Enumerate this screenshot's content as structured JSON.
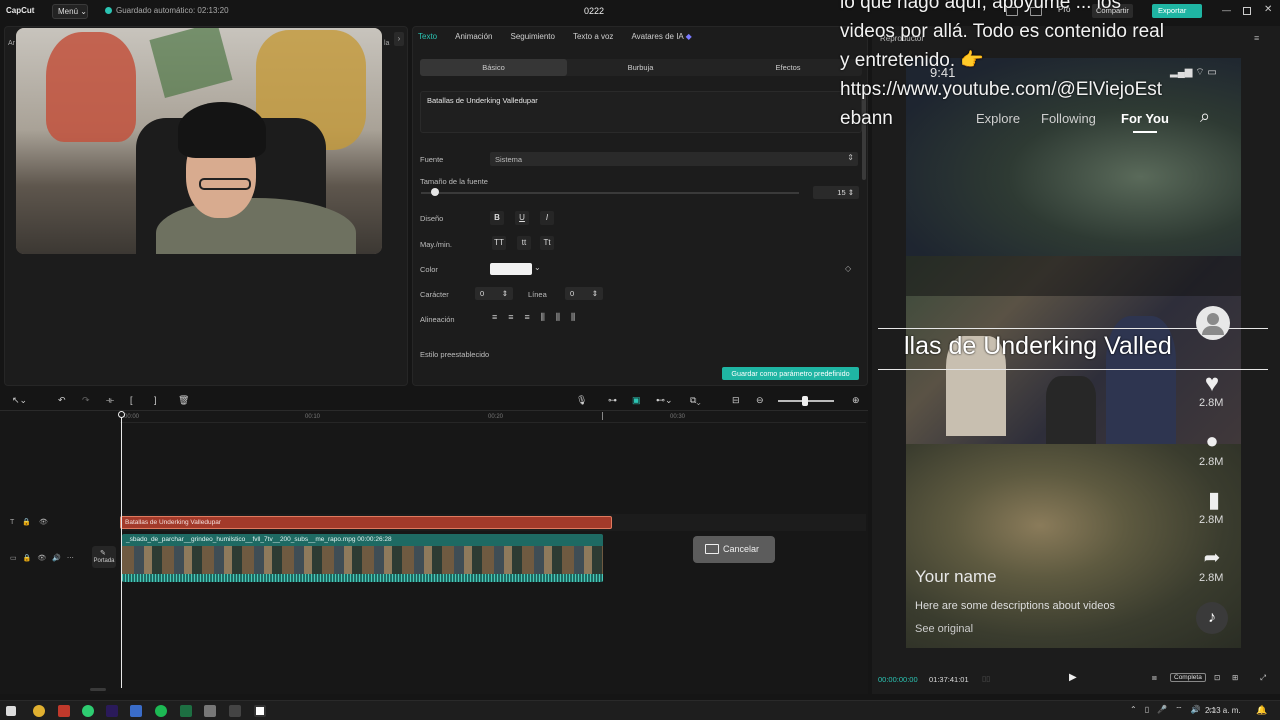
{
  "titlebar": {
    "logo": "CapCut",
    "menu": "Menú ⌄",
    "autosave": "Guardado automático: 02:13:20",
    "project": "0222",
    "pro": "Pro",
    "share": "Compartir",
    "export": "Exportar"
  },
  "media": {
    "side_label_left": "Ar",
    "side_label_right": "la"
  },
  "inspector": {
    "tabs": [
      "Texto",
      "Animación",
      "Seguimiento",
      "Texto a voz",
      "Avatares de IA"
    ],
    "subtabs": [
      "Básico",
      "Burbuja",
      "Efectos"
    ],
    "text_value": "Batallas de Underking Valledupar",
    "font_label": "Fuente",
    "font_value": "Sistema",
    "size_label": "Tamaño de la fuente",
    "size_value": "15",
    "size_fraction": 0.03,
    "design_label": "Diseño",
    "design_buttons": [
      "B",
      "U",
      "I"
    ],
    "case_label": "May./min.",
    "case_buttons": [
      "TT",
      "tt",
      "Tt"
    ],
    "color_label": "Color",
    "color_value": "#f2f2f2",
    "char_label": "Carácter",
    "char_value": "0",
    "line_label": "Línea",
    "line_value": "0",
    "align_label": "Alineación",
    "preset_label": "Estilo preestablecido",
    "save_default": "Guardar como parámetro predefinido"
  },
  "timeline": {
    "ticks": [
      "00:00",
      "00:10",
      "00:20",
      "00:30"
    ],
    "text_clip": "Batallas de Underking Valledupar",
    "video_clip": "_sbado_de_parchar__grindeo_humilstico__fvll_7tv__200_subs__me_rapo.mpg   00:00:26:28",
    "cover_label": "Portada",
    "cancel": "Cancelar"
  },
  "player": {
    "title": "Reproductor",
    "overlay_lines": [
      "lo que hago aquí, apoyume ... los",
      "videos por allá. Todo es contenido real",
      "y entretenido. 👉",
      "https://www.youtube.com/@ElViejoEst",
      "ebann"
    ],
    "status_time": "9:41",
    "nav": [
      "Explore",
      "Following",
      "For You"
    ],
    "caption": "llas de Underking Valled",
    "counts": [
      "2.8M",
      "2.8M",
      "2.8M",
      "2.8M"
    ],
    "your_name": "Your name",
    "description": "Here are some descriptions about videos",
    "see_original": "See original",
    "time_current": "00:00:00:00",
    "time_total": "01:37:41:01",
    "fit_label": "Completa"
  },
  "taskbar": {
    "clock": "2:13 a. m."
  },
  "colors": {
    "accent": "#2bc4b3",
    "text_clip": "#a33a2a",
    "video_clip": "#1e6a63"
  }
}
